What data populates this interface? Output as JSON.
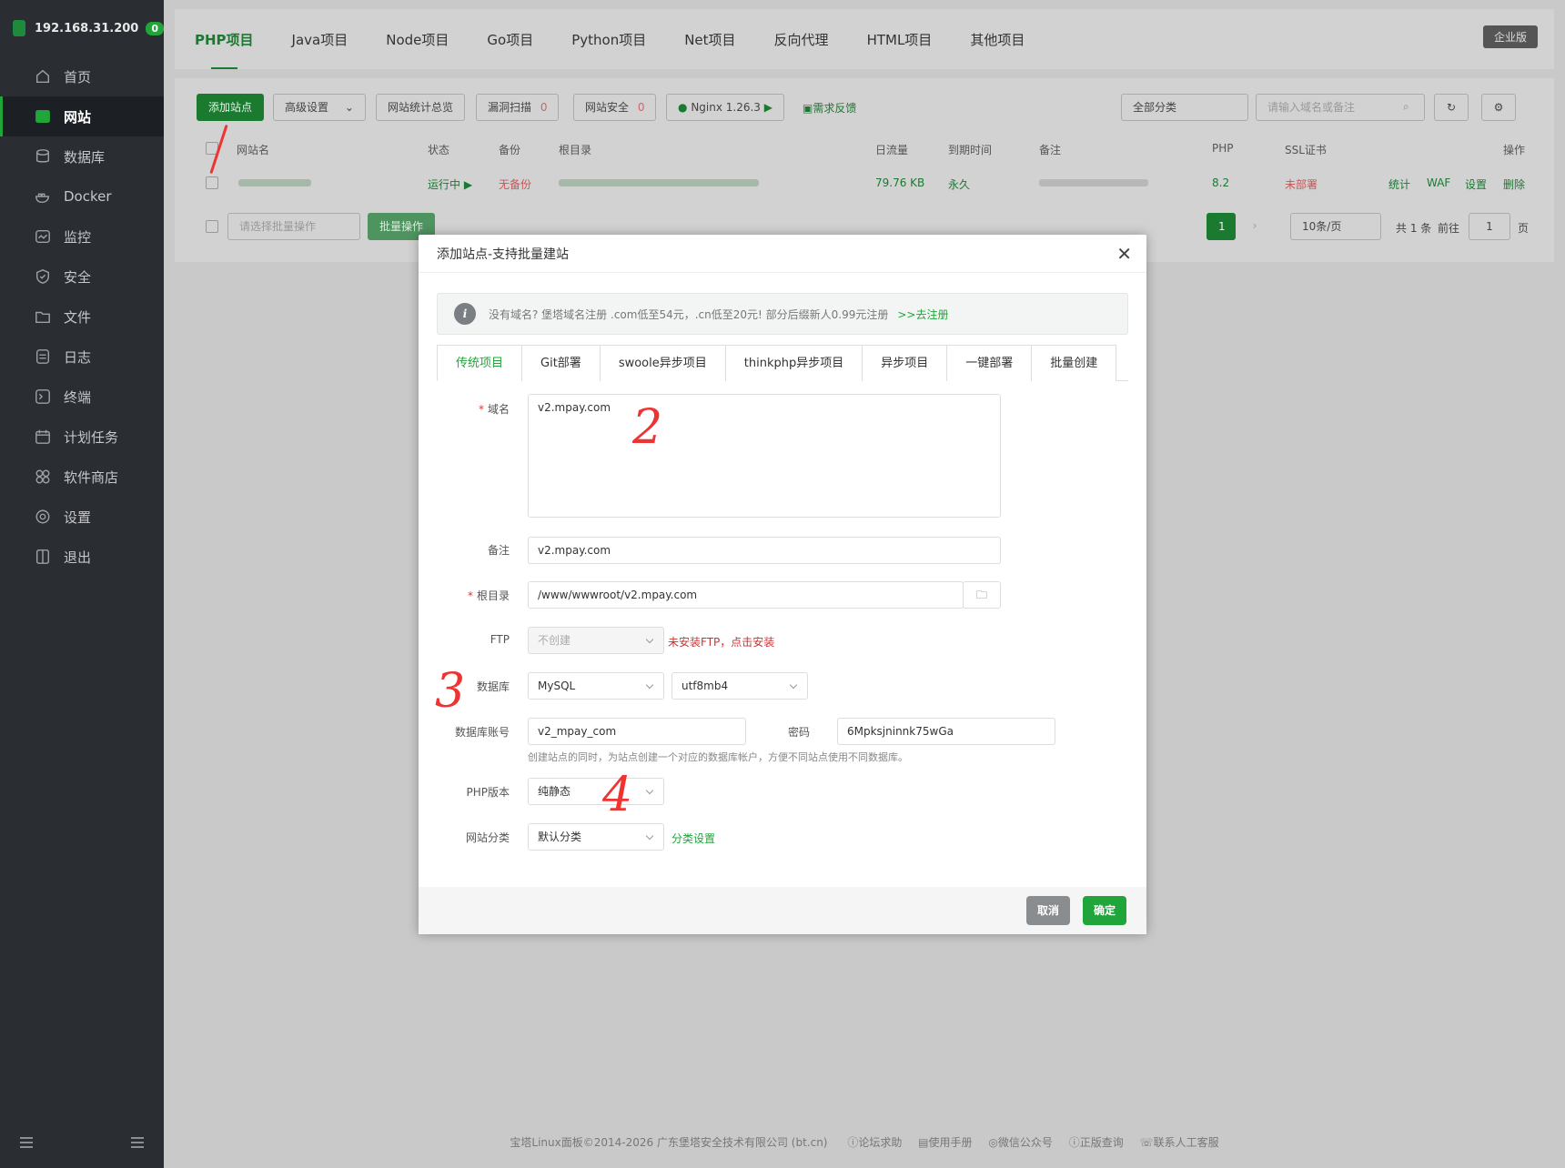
{
  "sidebar": {
    "ip": "192.168.31.200",
    "badge": "0",
    "items": [
      {
        "label": "首页",
        "icon": "home-icon"
      },
      {
        "label": "网站",
        "icon": "website-icon"
      },
      {
        "label": "数据库",
        "icon": "database-icon"
      },
      {
        "label": "Docker",
        "icon": "docker-icon"
      },
      {
        "label": "监控",
        "icon": "monitor-icon"
      },
      {
        "label": "安全",
        "icon": "shield-icon"
      },
      {
        "label": "文件",
        "icon": "folder-icon"
      },
      {
        "label": "日志",
        "icon": "log-icon"
      },
      {
        "label": "终端",
        "icon": "terminal-icon"
      },
      {
        "label": "计划任务",
        "icon": "calendar-icon"
      },
      {
        "label": "软件商店",
        "icon": "apps-icon"
      },
      {
        "label": "设置",
        "icon": "gear-icon"
      },
      {
        "label": "退出",
        "icon": "logout-icon"
      }
    ]
  },
  "topnav": {
    "tabs": [
      "PHP项目",
      "Java项目",
      "Node项目",
      "Go项目",
      "Python项目",
      "Net项目",
      "反向代理",
      "HTML项目",
      "其他项目"
    ],
    "enterprise": "企业版"
  },
  "toolbar": {
    "add_site": "添加站点",
    "advanced": "高级设置",
    "stats": "网站统计总览",
    "vuln_scan": "漏洞扫描",
    "vuln_count": "0",
    "site_security": "网站安全",
    "security_count": "0",
    "nginx": "Nginx 1.26.3",
    "feedback": "需求反馈",
    "category": "全部分类",
    "search_placeholder": "请输入域名或备注"
  },
  "table": {
    "headers": [
      "网站名",
      "状态",
      "备份",
      "根目录",
      "日流量",
      "到期时间",
      "备注",
      "PHP",
      "SSL证书",
      "操作"
    ],
    "row": {
      "status": "运行中",
      "backup": "无备份",
      "traffic": "79.76 KB",
      "expire": "永久",
      "php": "8.2",
      "ssl": "未部署",
      "actions": [
        "统计",
        "WAF",
        "设置",
        "删除"
      ]
    },
    "batch_placeholder": "请选择批量操作",
    "batch_btn": "批量操作",
    "page": "1",
    "per_page": "10条/页",
    "total": "共 1 条",
    "goto": "前往",
    "goto_val": "1",
    "page_unit": "页"
  },
  "footer": {
    "copyright": "宝塔Linux面板©2014-2026 广东堡塔安全技术有限公司 (bt.cn)",
    "links": [
      "论坛求助",
      "使用手册",
      "微信公众号",
      "正版查询",
      "联系人工客服"
    ]
  },
  "modal": {
    "title": "添加站点-支持批量建站",
    "notice": "没有域名? 堡塔域名注册 .com低至54元，.cn低至20元! 部分后缀新人0.99元注册",
    "notice_link": ">>去注册",
    "tabs": [
      "传统项目",
      "Git部署",
      "swoole异步项目",
      "thinkphp异步项目",
      "异步项目",
      "一键部署",
      "批量创建"
    ],
    "domain_label": "域名",
    "domain_value": "v2.mpay.com",
    "remark_label": "备注",
    "remark_value": "v2.mpay.com",
    "root_label": "根目录",
    "root_value": "/www/wwwroot/v2.mpay.com",
    "ftp_label": "FTP",
    "ftp_value": "不创建",
    "ftp_warn": "未安装FTP，点击安装",
    "db_label": "数据库",
    "db_type": "MySQL",
    "db_charset": "utf8mb4",
    "db_account_label": "数据库账号",
    "db_account": "v2_mpay_com",
    "password_label": "密码",
    "password": "6Mpksjninnk75wGa",
    "db_hint": "创建站点的同时，为站点创建一个对应的数据库帐户，方便不同站点使用不同数据库。",
    "php_label": "PHP版本",
    "php_value": "纯静态",
    "category_label": "网站分类",
    "category_value": "默认分类",
    "category_link": "分类设置",
    "cancel": "取消",
    "confirm": "确定"
  },
  "annotations": [
    "2",
    "3",
    "4"
  ]
}
